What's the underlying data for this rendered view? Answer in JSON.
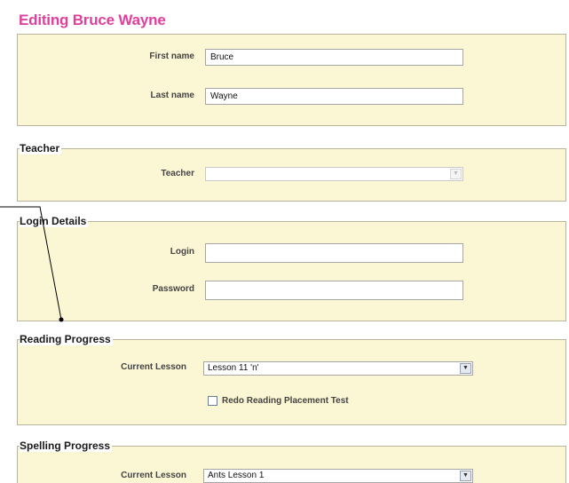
{
  "page": {
    "title": "Editing Bruce Wayne"
  },
  "name_section": {
    "first_name_label": "First name",
    "first_name_value": "Bruce",
    "last_name_label": "Last name",
    "last_name_value": "Wayne"
  },
  "teacher_section": {
    "legend": "Teacher",
    "teacher_label": "Teacher",
    "teacher_value": ""
  },
  "login_section": {
    "legend": "Login Details",
    "login_label": "Login",
    "login_value": "",
    "password_label": "Password",
    "password_value": ""
  },
  "reading_section": {
    "legend": "Reading Progress",
    "current_lesson_label": "Current Lesson",
    "current_lesson_value": "Lesson 11 'n'",
    "redo_label": "Redo Reading Placement Test",
    "redo_checked": false
  },
  "spelling_section": {
    "legend": "Spelling Progress",
    "current_lesson_label": "Current Lesson",
    "current_lesson_value": "Ants Lesson 1"
  },
  "colors": {
    "title": "#e0409b",
    "panel_background": "#fbf6d3",
    "panel_border": "#b9b49a"
  },
  "icons": {
    "dropdown": "chevron-down-icon"
  }
}
